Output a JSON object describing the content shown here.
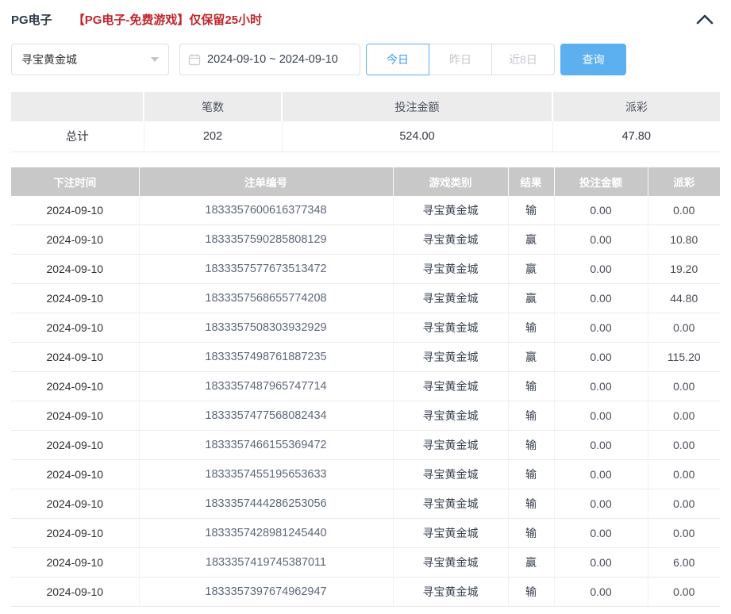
{
  "header": {
    "title": "PG电子",
    "notice": "【PG电子-免费游戏】仅保留25小时"
  },
  "filters": {
    "game_select": {
      "value": "寻宝黄金城"
    },
    "date_range": "2024-09-10 ~ 2024-09-10",
    "quick_buttons": [
      {
        "label": "今日",
        "active": true
      },
      {
        "label": "昨日",
        "active": false
      },
      {
        "label": "近8日",
        "active": false
      }
    ],
    "search_label": "查询"
  },
  "colors": {
    "accent_blue": "#5cb0f0",
    "active_blue": "#3f9cf0",
    "notice_red": "#c0262c",
    "header_grey": "#c8c8c8",
    "summary_header_grey": "#ececec"
  },
  "summary": {
    "headers": [
      "",
      "笔数",
      "投注金额",
      "派彩"
    ],
    "row": {
      "label": "总计",
      "count": "202",
      "bet_amount": "524.00",
      "payout": "47.80"
    }
  },
  "table": {
    "headers": [
      "下注时间",
      "注单编号",
      "游戏类别",
      "结果",
      "投注金额",
      "派彩"
    ],
    "rows": [
      {
        "date": "2024-09-10",
        "id": "1833357600616377348",
        "game": "寻宝黄金城",
        "result": "输",
        "bet": "0.00",
        "payout": "0.00"
      },
      {
        "date": "2024-09-10",
        "id": "1833357590285808129",
        "game": "寻宝黄金城",
        "result": "赢",
        "bet": "0.00",
        "payout": "10.80"
      },
      {
        "date": "2024-09-10",
        "id": "1833357577673513472",
        "game": "寻宝黄金城",
        "result": "赢",
        "bet": "0.00",
        "payout": "19.20"
      },
      {
        "date": "2024-09-10",
        "id": "1833357568655774208",
        "game": "寻宝黄金城",
        "result": "赢",
        "bet": "0.00",
        "payout": "44.80"
      },
      {
        "date": "2024-09-10",
        "id": "1833357508303932929",
        "game": "寻宝黄金城",
        "result": "输",
        "bet": "0.00",
        "payout": "0.00"
      },
      {
        "date": "2024-09-10",
        "id": "1833357498761887235",
        "game": "寻宝黄金城",
        "result": "赢",
        "bet": "0.00",
        "payout": "115.20"
      },
      {
        "date": "2024-09-10",
        "id": "1833357487965747714",
        "game": "寻宝黄金城",
        "result": "输",
        "bet": "0.00",
        "payout": "0.00"
      },
      {
        "date": "2024-09-10",
        "id": "1833357477568082434",
        "game": "寻宝黄金城",
        "result": "输",
        "bet": "0.00",
        "payout": "0.00"
      },
      {
        "date": "2024-09-10",
        "id": "1833357466155369472",
        "game": "寻宝黄金城",
        "result": "输",
        "bet": "0.00",
        "payout": "0.00"
      },
      {
        "date": "2024-09-10",
        "id": "1833357455195653633",
        "game": "寻宝黄金城",
        "result": "输",
        "bet": "0.00",
        "payout": "0.00"
      },
      {
        "date": "2024-09-10",
        "id": "1833357444286253056",
        "game": "寻宝黄金城",
        "result": "输",
        "bet": "0.00",
        "payout": "0.00"
      },
      {
        "date": "2024-09-10",
        "id": "1833357428981245440",
        "game": "寻宝黄金城",
        "result": "输",
        "bet": "0.00",
        "payout": "0.00"
      },
      {
        "date": "2024-09-10",
        "id": "1833357419745387011",
        "game": "寻宝黄金城",
        "result": "赢",
        "bet": "0.00",
        "payout": "6.00"
      },
      {
        "date": "2024-09-10",
        "id": "1833357397674962947",
        "game": "寻宝黄金城",
        "result": "输",
        "bet": "0.00",
        "payout": "0.00"
      }
    ]
  }
}
